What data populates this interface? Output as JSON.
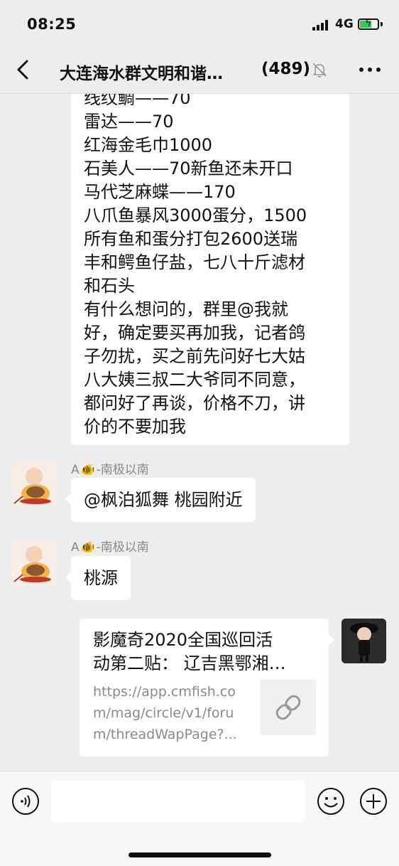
{
  "status_bar": {
    "time": "08:25",
    "network": "4G"
  },
  "header": {
    "title": "大连海水群文明和谐…",
    "member_count": "(489)",
    "back_icon": "chevron-left-icon",
    "mute_icon": "bell-slash-icon",
    "more_icon": "ellipsis-icon"
  },
  "messages": {
    "long_text_lines": [
      "线纹鲷——70",
      "雷达——70",
      "红海金毛巾1000",
      "石美人——70新鱼还未开口",
      "马代芝麻蝶——170",
      "八爪鱼暴风3000蛋分，1500",
      "所有鱼和蛋分打包2600送瑞",
      "丰和鳄鱼仔盐，七八十斤滤材",
      "和石头",
      "有什么想问的，群里@我就",
      "好，确定要买再加我，记者鸽",
      "子勿扰，买之前先问好七大姑",
      "八大姨三叔二大爷同不同意，",
      "都问好了再谈，价格不刀，讲",
      "价的不要加我"
    ],
    "msg1": {
      "sender_prefix": "A",
      "sender_emoji": "🐠",
      "sender_suffix": "-南极以南",
      "text": "@枫泊狐舞 桃园附近"
    },
    "msg2": {
      "sender_prefix": "A",
      "sender_emoji": "🐠",
      "sender_suffix": "-南极以南",
      "text": "桃源"
    },
    "link": {
      "title_line1": "影魔奇2020全国巡回活",
      "title_line2": "动第二贴： 辽吉黑鄂湘…",
      "url_line1": "https://app.cmfish.co",
      "url_line2": "m/mag/circle/v1/foru",
      "url_line3": "m/threadWapPage?..."
    }
  },
  "input_bar": {
    "voice_icon": "voice-icon",
    "emoji_icon": "emoji-icon",
    "plus_icon": "plus-icon"
  },
  "colors": {
    "background": "#ededed",
    "bubble": "#ffffff",
    "battery": "#34c759",
    "muted_text": "#8a8a8a"
  }
}
